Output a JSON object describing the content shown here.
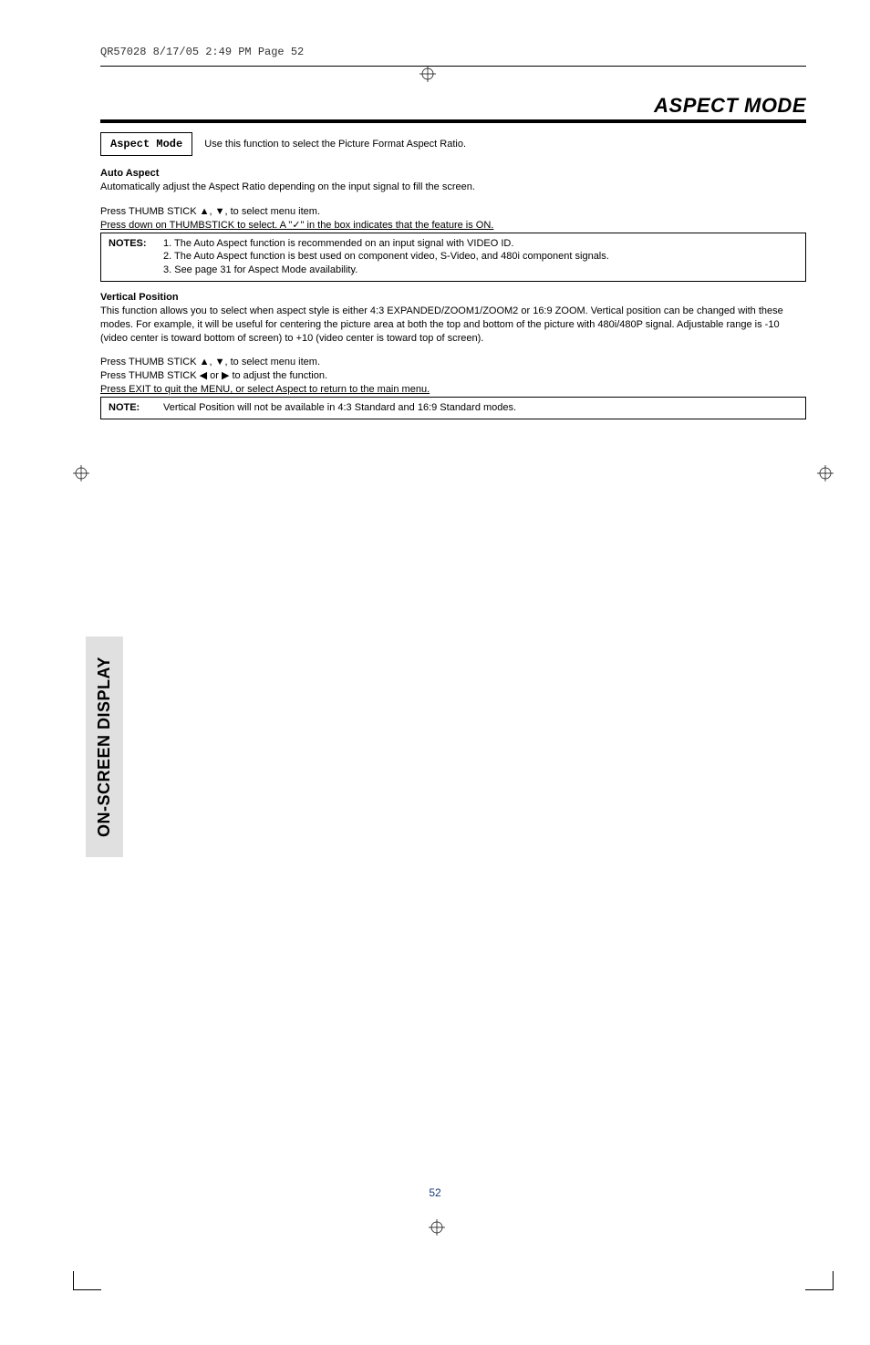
{
  "header_line": "QR57028  8/17/05  2:49 PM  Page 52",
  "title": "ASPECT MODE",
  "aspect_mode": {
    "label": "Aspect Mode",
    "description": "Use this function to select the Picture Format Aspect Ratio."
  },
  "auto_aspect": {
    "heading": "Auto Aspect",
    "line1": "Automatically adjust the Aspect Ratio depending on the input signal to fill the screen.",
    "line2": "Press THUMB STICK ▲, ▼, to select menu item.",
    "line3": "Press down on THUMBSTICK to select.  A \"✓\" in the box indicates that the feature is ON.",
    "notes_label": "NOTES:",
    "notes": [
      "1. The Auto Aspect function is recommended on an input signal with VIDEO ID.",
      "2. The Auto Aspect function is best used on component video, S-Video, and 480i component signals.",
      "3. See page 31 for Aspect Mode availability."
    ]
  },
  "vertical_position": {
    "heading": "Vertical Position",
    "body": "This function allows you to select when aspect style is either 4:3 EXPANDED/ZOOM1/ZOOM2 or 16:9 ZOOM.  Vertical position can be changed with these modes.  For example, it will be useful for centering the picture area at both the top and bottom of the picture with 480i/480P signal.  Adjustable range is -10 (video center is toward bottom of screen) to +10 (video center is toward top of screen).",
    "line2": "Press THUMB STICK ▲, ▼, to select menu item.",
    "line3": "Press THUMB STICK  ◀ or ▶ to adjust the function.",
    "line4": "Press EXIT to quit the MENU, or select Aspect to return to the main menu.",
    "note_label": "NOTE:",
    "note_body": "Vertical Position will not be available in 4:3 Standard and 16:9 Standard modes."
  },
  "side_tab": "ON-SCREEN DISPLAY",
  "page_number": "52"
}
